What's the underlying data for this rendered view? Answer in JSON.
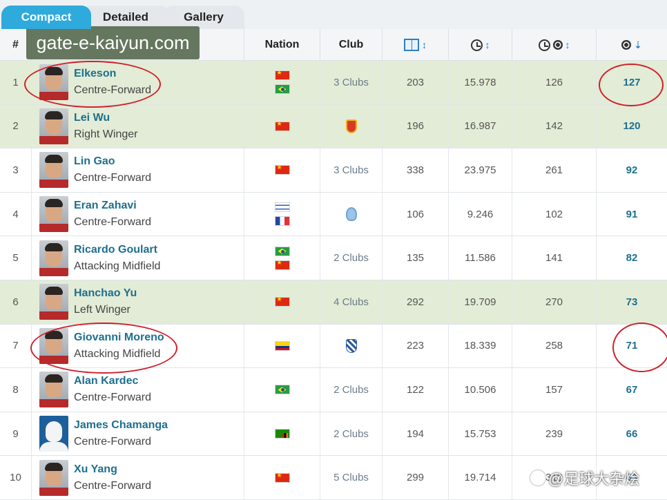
{
  "tabs": [
    {
      "label": "Compact",
      "active": true
    },
    {
      "label": "Detailed",
      "active": false
    },
    {
      "label": "Gallery",
      "active": false
    }
  ],
  "columns": {
    "rank": "#",
    "nation": "Nation",
    "club": "Club",
    "apps_icon": "pitch-icon",
    "mins_icon": "clock-icon",
    "mpg_icon": "clock-ball-icon",
    "goals_icon": "ball-icon",
    "sort_icon": "sort-arrows-icon",
    "sort_desc_icon": "sort-down-icon"
  },
  "watermark": "gate-e-kaiyun.com",
  "weibo_watermark": "@足球大杂烩",
  "colors": {
    "accent_tab": "#2eaadc",
    "highlight_row": "#e3ecd6",
    "link": "#1d6f8f",
    "annotation": "#d0202a"
  },
  "rows": [
    {
      "rank": "1",
      "name": "Elkeson",
      "position": "Centre-Forward",
      "nations": [
        "cn",
        "br"
      ],
      "club": "3 Clubs",
      "club_crest": "",
      "apps": "203",
      "mins": "15.978",
      "mpg": "126",
      "goals": "127",
      "highlight": true
    },
    {
      "rank": "2",
      "name": "Lei Wu",
      "position": "Right Winger",
      "nations": [
        "cn"
      ],
      "club": "",
      "club_crest": "red",
      "apps": "196",
      "mins": "16.987",
      "mpg": "142",
      "goals": "120",
      "highlight": true
    },
    {
      "rank": "3",
      "name": "Lin Gao",
      "position": "Centre-Forward",
      "nations": [
        "cn"
      ],
      "club": "3 Clubs",
      "club_crest": "",
      "apps": "338",
      "mins": "23.975",
      "mpg": "261",
      "goals": "92",
      "highlight": false
    },
    {
      "rank": "4",
      "name": "Eran Zahavi",
      "position": "Centre-Forward",
      "nations": [
        "il",
        "fr"
      ],
      "club": "",
      "club_crest": "blue",
      "apps": "106",
      "mins": "9.246",
      "mpg": "102",
      "goals": "91",
      "highlight": false
    },
    {
      "rank": "5",
      "name": "Ricardo Goulart",
      "position": "Attacking Midfield",
      "nations": [
        "br",
        "cn"
      ],
      "club": "2 Clubs",
      "club_crest": "",
      "apps": "135",
      "mins": "11.586",
      "mpg": "141",
      "goals": "82",
      "highlight": false
    },
    {
      "rank": "6",
      "name": "Hanchao Yu",
      "position": "Left Winger",
      "nations": [
        "cn"
      ],
      "club": "4 Clubs",
      "club_crest": "",
      "apps": "292",
      "mins": "19.709",
      "mpg": "270",
      "goals": "73",
      "highlight": true
    },
    {
      "rank": "7",
      "name": "Giovanni Moreno",
      "position": "Attacking Midfield",
      "nations": [
        "co"
      ],
      "club": "",
      "club_crest": "shenhua",
      "apps": "223",
      "mins": "18.339",
      "mpg": "258",
      "goals": "71",
      "highlight": false
    },
    {
      "rank": "8",
      "name": "Alan Kardec",
      "position": "Centre-Forward",
      "nations": [
        "br"
      ],
      "club": "2 Clubs",
      "club_crest": "",
      "apps": "122",
      "mins": "10.506",
      "mpg": "157",
      "goals": "67",
      "highlight": false
    },
    {
      "rank": "9",
      "name": "James Chamanga",
      "position": "Centre-Forward",
      "nations": [
        "zm"
      ],
      "club": "2 Clubs",
      "club_crest": "",
      "apps": "194",
      "mins": "15.753",
      "mpg": "239",
      "goals": "66",
      "highlight": false
    },
    {
      "rank": "10",
      "name": "Xu Yang",
      "position": "Centre-Forward",
      "nations": [
        "cn"
      ],
      "club": "5 Clubs",
      "club_crest": "",
      "apps": "299",
      "mins": "19.714",
      "mpg": "310",
      "goals": "63",
      "highlight": false
    }
  ]
}
